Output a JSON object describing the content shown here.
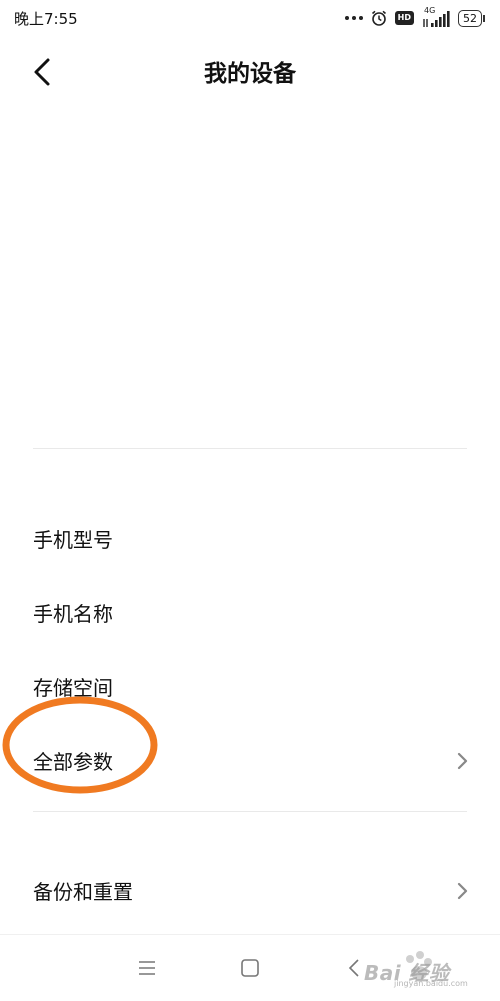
{
  "status_bar": {
    "time": "晚上7:55",
    "hd": "HD",
    "network": "4G",
    "battery": "52"
  },
  "header": {
    "title": "我的设备"
  },
  "list": {
    "model": "手机型号",
    "name": "手机名称",
    "storage": "存储空间",
    "all_params": "全部参数",
    "backup_reset": "备份和重置"
  },
  "watermark": {
    "brand": "Bai 经验",
    "url": "jingyan.baidu.com"
  },
  "colors": {
    "highlight": "#f07a21",
    "divider": "#e9e9e9",
    "chevron": "#888888"
  }
}
